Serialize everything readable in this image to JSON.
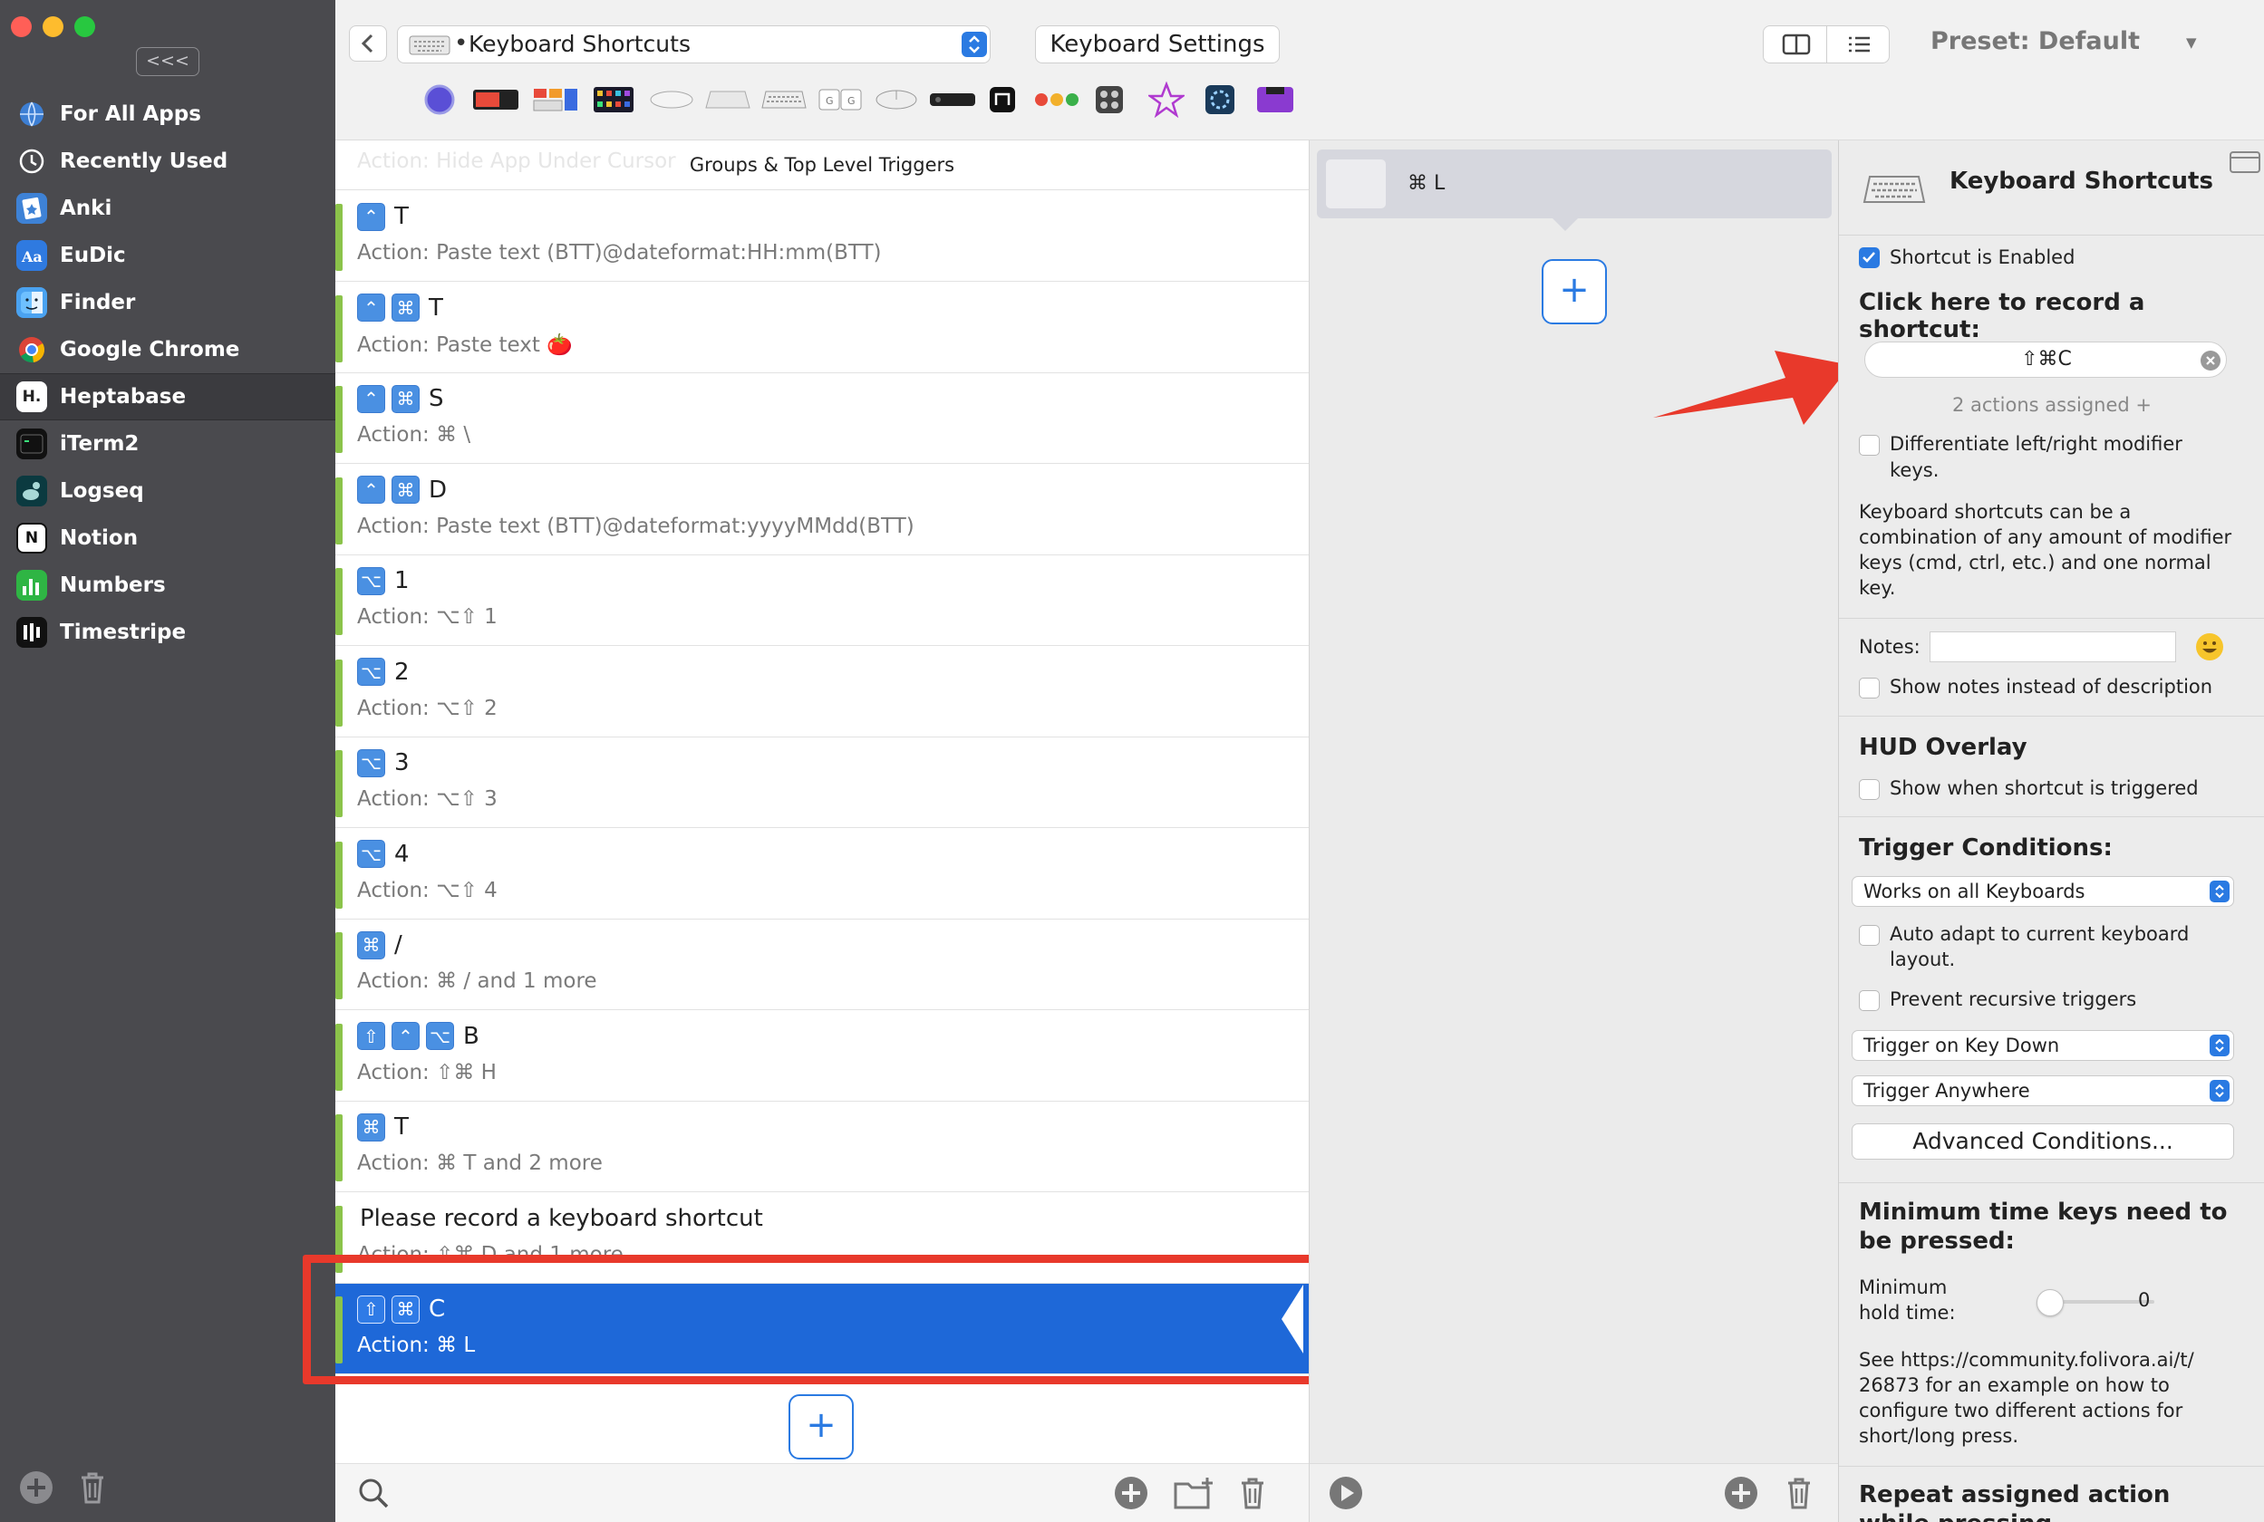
{
  "sidebar": {
    "collapse_label": "<<<",
    "apps": [
      {
        "label": "For All Apps",
        "icon": "globe-icon",
        "color": "#3d7fd4"
      },
      {
        "label": "Recently Used",
        "icon": "clock-icon",
        "color": "#5a5a5e"
      },
      {
        "label": "Anki",
        "icon": "anki-icon",
        "color": "#3e82d6"
      },
      {
        "label": "EuDic",
        "icon": "eudic-icon",
        "color": "#2f7ae0"
      },
      {
        "label": "Finder",
        "icon": "finder-icon",
        "color": "#4aa2f0"
      },
      {
        "label": "Google Chrome",
        "icon": "chrome-icon",
        "color": "#e8e8e8"
      },
      {
        "label": "Heptabase",
        "icon": "heptabase-icon",
        "color": "#222222"
      },
      {
        "label": "iTerm2",
        "icon": "iterm-icon",
        "color": "#111111"
      },
      {
        "label": "Logseq",
        "icon": "logseq-icon",
        "color": "#0b3a40"
      },
      {
        "label": "Notion",
        "icon": "notion-icon",
        "color": "#ffffff"
      },
      {
        "label": "Numbers",
        "icon": "numbers-icon",
        "color": "#2fb544"
      },
      {
        "label": "Timestripe",
        "icon": "timestripe-icon",
        "color": "#111111"
      }
    ],
    "heptabase_glyph": "H.",
    "selected_index": 6
  },
  "toolbar": {
    "trigger_type": "Keyboard Shortcuts",
    "settings_button": "Keyboard Settings",
    "preset": "Preset: Default"
  },
  "list": {
    "ghost_text": "Action: Hide App Under Cursor",
    "header": "Groups & Top Level Triggers",
    "triggers": [
      {
        "mods": [
          "⌃"
        ],
        "key": "T",
        "action": "Action: Paste text (BTT)@dateformat:HH:mm(BTT)"
      },
      {
        "mods": [
          "⌃",
          "⌘"
        ],
        "key": "T",
        "action": "Action: Paste text 🍅"
      },
      {
        "mods": [
          "⌃",
          "⌘"
        ],
        "key": "S",
        "action": "Action: ⌘ \\"
      },
      {
        "mods": [
          "⌃",
          "⌘"
        ],
        "key": "D",
        "action": "Action: Paste text (BTT)@dateformat:yyyyMMdd(BTT)"
      },
      {
        "mods": [
          "⌥"
        ],
        "key": "1",
        "action": "Action: ⌥⇧ 1"
      },
      {
        "mods": [
          "⌥"
        ],
        "key": "2",
        "action": "Action: ⌥⇧ 2"
      },
      {
        "mods": [
          "⌥"
        ],
        "key": "3",
        "action": "Action: ⌥⇧ 3"
      },
      {
        "mods": [
          "⌥"
        ],
        "key": "4",
        "action": "Action: ⌥⇧ 4"
      },
      {
        "mods": [
          "⌘"
        ],
        "key": "/",
        "action": "Action: ⌘ / and 1 more"
      },
      {
        "mods": [
          "⇧",
          "⌃",
          "⌥"
        ],
        "key": "B",
        "action": "Action: ⇧⌘ H"
      },
      {
        "mods": [
          "⌘"
        ],
        "key": "T",
        "action": "Action: ⌘ T and 2 more"
      },
      {
        "mods": [],
        "key": "Please record a keyboard shortcut",
        "action": "Action: ⇧⌘ D and 1 more"
      },
      {
        "mods": [
          "⇧",
          "⌘"
        ],
        "key": "C",
        "action": "Action: ⌘ L"
      }
    ],
    "selected_index": 12,
    "add_label": "+"
  },
  "actions_panel": {
    "action_label": "⌘ L",
    "add_label": "+"
  },
  "inspector": {
    "title": "Keyboard Shortcuts",
    "enabled_label": "Shortcut is Enabled",
    "record_heading": "Click here to record a shortcut:",
    "shortcut_value": "⇧⌘C",
    "actions_assigned": "2 actions assigned +",
    "differentiate_label_1": "Differentiate left/right modifier",
    "differentiate_label_2": "keys.",
    "desc_1": "Keyboard shortcuts can be a",
    "desc_2": "combination of any amount of modifier",
    "desc_3": "keys (cmd, ctrl, etc.) and one normal",
    "desc_4": "key.",
    "notes_label": "Notes:",
    "show_notes_label": "Show notes instead of description",
    "hud_heading": "HUD Overlay",
    "hud_label": "Show when shortcut is triggered",
    "conditions_heading": "Trigger Conditions:",
    "keyboard_select": "Works on all Keyboards",
    "auto_adapt_1": "Auto adapt to current keyboard",
    "auto_adapt_2": "layout.",
    "prevent_label": "Prevent recursive triggers",
    "trigger_on_select": "Trigger on Key Down",
    "trigger_where_select": "Trigger Anywhere",
    "advanced_button": "Advanced Conditions...",
    "min_time_heading_1": "Minimum time keys need to",
    "min_time_heading_2": "be pressed:",
    "min_hold_1": "Minimum",
    "min_hold_2": "hold time:",
    "min_hold_value": "0",
    "see_1": "See https://community.folivora.ai/t/",
    "see_2": "26873 for an example on how to",
    "see_3": "configure two different actions for",
    "see_4": "short/long press.",
    "repeat_heading_1": "Repeat assigned action",
    "repeat_heading_2": "while pressing"
  },
  "colors": {
    "accent": "#2a7ae2",
    "selection": "#1e68d8",
    "annotation_red": "#e8392b",
    "trigger_bar": "#8bc34a"
  }
}
